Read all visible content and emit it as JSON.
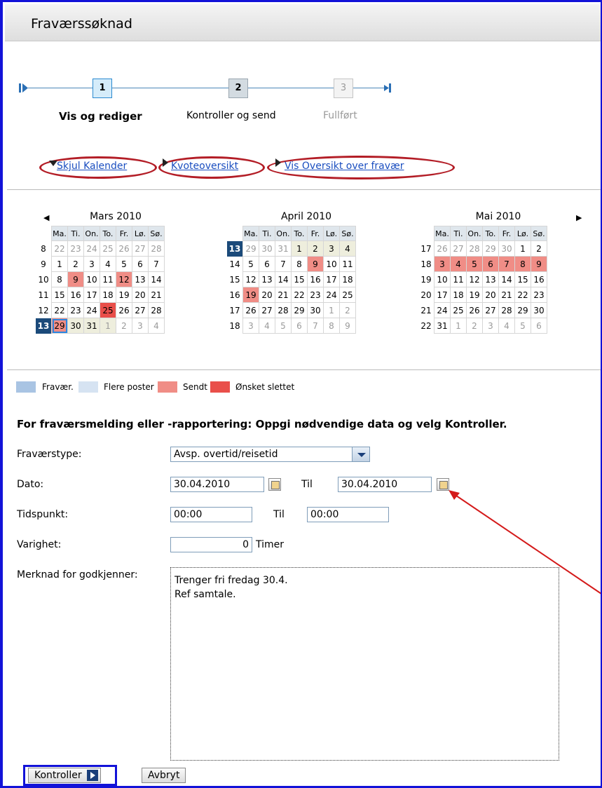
{
  "title": "Fraværssøknad",
  "roadmap": {
    "steps": [
      {
        "num": "1",
        "label": "Vis og rediger"
      },
      {
        "num": "2",
        "label": "Kontroller og send"
      },
      {
        "num": "3",
        "label": "Fullført"
      }
    ]
  },
  "links": {
    "hide_calendar": "Skjul Kalender",
    "quota": "Kvoteoversikt",
    "overview": "Vis Oversikt over fravær"
  },
  "calendar": {
    "weekday_headers": [
      "Ma.",
      "Ti.",
      "On.",
      "To.",
      "Fr.",
      "Lø.",
      "Sø."
    ],
    "months": [
      {
        "title": "Mars 2010",
        "weeks": [
          "8",
          "9",
          "10",
          "11",
          "12",
          "13"
        ],
        "days": [
          [
            "22",
            "23",
            "24",
            "25",
            "26",
            "27",
            "28"
          ],
          [
            "1",
            "2",
            "3",
            "4",
            "5",
            "6",
            "7"
          ],
          [
            "8",
            "9",
            "10",
            "11",
            "12",
            "13",
            "14"
          ],
          [
            "15",
            "16",
            "17",
            "18",
            "19",
            "20",
            "21"
          ],
          [
            "22",
            "23",
            "24",
            "25",
            "26",
            "27",
            "28"
          ],
          [
            "29",
            "30",
            "31",
            "1",
            "2",
            "3",
            "4"
          ]
        ]
      },
      {
        "title": "April 2010",
        "weeks": [
          "13",
          "14",
          "15",
          "16",
          "17",
          "18"
        ],
        "days": [
          [
            "29",
            "30",
            "31",
            "1",
            "2",
            "3",
            "4"
          ],
          [
            "5",
            "6",
            "7",
            "8",
            "9",
            "10",
            "11"
          ],
          [
            "12",
            "13",
            "14",
            "15",
            "16",
            "17",
            "18"
          ],
          [
            "19",
            "20",
            "21",
            "22",
            "23",
            "24",
            "25"
          ],
          [
            "26",
            "27",
            "28",
            "29",
            "30",
            "1",
            "2"
          ],
          [
            "3",
            "4",
            "5",
            "6",
            "7",
            "8",
            "9"
          ]
        ]
      },
      {
        "title": "Mai 2010",
        "weeks": [
          "17",
          "18",
          "19",
          "20",
          "21",
          "22"
        ],
        "days": [
          [
            "26",
            "27",
            "28",
            "29",
            "30",
            "1",
            "2"
          ],
          [
            "3",
            "4",
            "5",
            "6",
            "7",
            "8",
            "9"
          ],
          [
            "10",
            "11",
            "12",
            "13",
            "14",
            "15",
            "16"
          ],
          [
            "17",
            "18",
            "19",
            "20",
            "21",
            "22",
            "23"
          ],
          [
            "24",
            "25",
            "26",
            "27",
            "28",
            "29",
            "30"
          ],
          [
            "31",
            "1",
            "2",
            "3",
            "4",
            "5",
            "6"
          ]
        ]
      }
    ],
    "legend": [
      {
        "label": "Fravær.",
        "color": "#a9c4e3"
      },
      {
        "label": "Flere poster",
        "color": "#d6e3f2"
      },
      {
        "label": "Sendt",
        "color": "#f08d86"
      },
      {
        "label": "Ønsket slettet",
        "color": "#e94f4a"
      }
    ]
  },
  "form": {
    "instruction": "For fraværsmelding eller -rapportering: Oppgi nødvendige data og velg Kontroller.",
    "type_label": "Fraværstype:",
    "type_value": "Avsp. overtid/reisetid",
    "date_label": "Dato:",
    "date_from": "30.04.2010",
    "date_to_label": "Til",
    "date_to": "30.04.2010",
    "time_label": "Tidspunkt:",
    "time_from": "00:00",
    "time_to_label": "Til",
    "time_to": "00:00",
    "duration_label": "Varighet:",
    "duration_value": "0",
    "duration_unit": "Timer",
    "note_label": "Merknad for godkjenner:",
    "note_value": "Trenger fri fredag 30.4.\nRef samtale."
  },
  "buttons": {
    "check": "Kontroller",
    "cancel": "Avbryt"
  },
  "colors": {
    "annotation_red": "#b31d26",
    "frame_blue": "#1212d8",
    "today": "#1b4a7a"
  }
}
